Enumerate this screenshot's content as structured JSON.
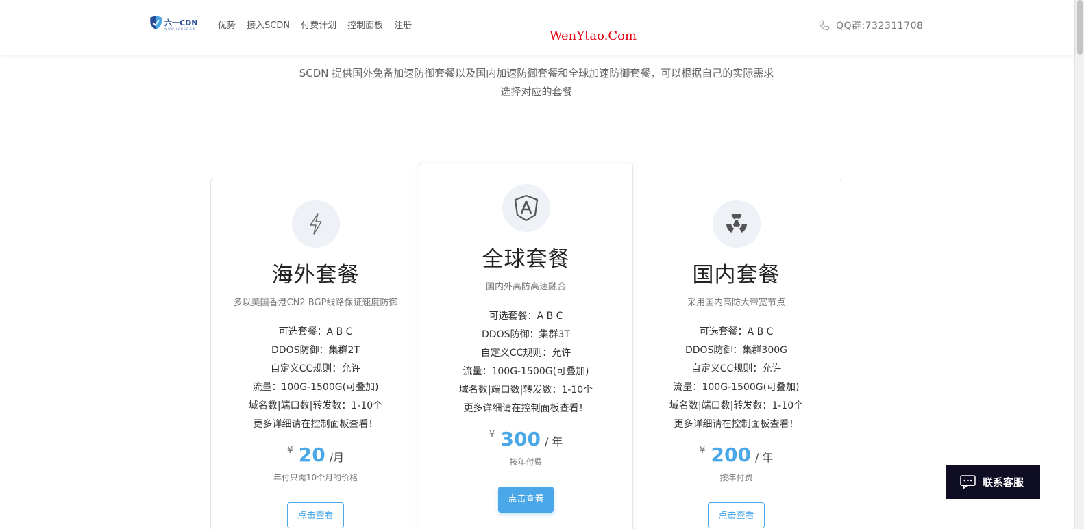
{
  "header": {
    "logo_text": "六一CDN",
    "logo_subtext": "WWW.LONGE.CN",
    "nav": [
      "优势",
      "接入SCDN",
      "付费计划",
      "控制面板",
      "注册"
    ],
    "watermark": "WenYtao.Com",
    "qq_label": "QQ群:732311708",
    "phone_icon": "phone-icon",
    "accent_color": "#4aa8e8"
  },
  "intro": {
    "line1": "SCDN 提供国外免备加速防御套餐以及国内加速防御套餐和全球加速防御套餐，可以根据自己的实际需求",
    "line2": "选择对应的套餐"
  },
  "plans": [
    {
      "icon": "lightning-icon",
      "title": "海外套餐",
      "subtitle": "多以美国香港CN2 BGP线路保证速度防御",
      "features": [
        "可选套餐：A B C",
        "DDOS防御：集群2T",
        "自定义CC规则：允许",
        "流量：100G-1500G(可叠加)",
        "域名数|端口数|转发数：1-10个",
        "更多详细请在控制面板查看！"
      ],
      "currency": "¥",
      "price": "20",
      "unit": "/月",
      "note": "年付只需10个月的价格",
      "button": "点击查看"
    },
    {
      "icon": "angular-icon",
      "title": "全球套餐",
      "subtitle": "国内外高防高速融合",
      "features": [
        "可选套餐：A B C",
        "DDOS防御：集群3T",
        "自定义CC规则：允许",
        "流量：100G-1500G(可叠加)",
        "域名数|端口数|转发数：1-10个",
        "更多详细请在控制面板查看！"
      ],
      "currency": "¥",
      "price": "300",
      "unit": "/ 年",
      "note": "按年付费",
      "button": "点击查看"
    },
    {
      "icon": "radiation-icon",
      "title": "国内套餐",
      "subtitle": "采用国内高防大带宽节点",
      "features": [
        "可选套餐：A B C",
        "DDOS防御：集群300G",
        "自定义CC规则：允许",
        "流量：100G-1500G(可叠加)",
        "域名数|端口数|转发数：1-10个",
        "更多详细请在控制面板查看！"
      ],
      "currency": "¥",
      "price": "200",
      "unit": "/ 年",
      "note": "按年付费",
      "button": "点击查看"
    }
  ],
  "customer_service": {
    "label": "联系客服",
    "icon": "chat-icon"
  }
}
